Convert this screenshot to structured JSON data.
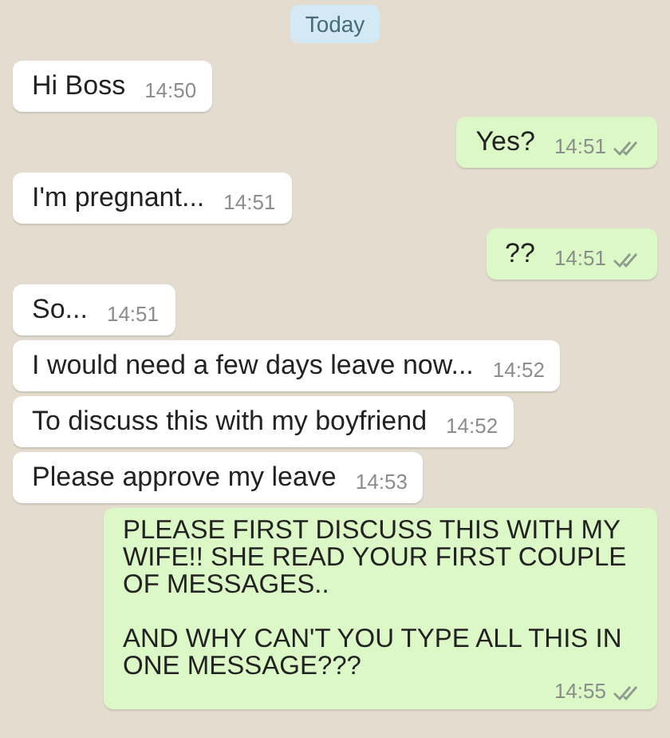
{
  "date_badge": "Today",
  "messages": [
    {
      "text": "Hi Boss",
      "time": "14:50",
      "outgoing": false
    },
    {
      "text": "Yes?",
      "time": "14:51",
      "outgoing": true
    },
    {
      "text": "I'm pregnant...",
      "time": "14:51",
      "outgoing": false
    },
    {
      "text": "??",
      "time": "14:51",
      "outgoing": true
    },
    {
      "text": "So...",
      "time": "14:51",
      "outgoing": false
    },
    {
      "text": "I would need a few days leave now...",
      "time": "14:52",
      "outgoing": false
    },
    {
      "text": "To discuss this with my boyfriend",
      "time": "14:52",
      "outgoing": false
    },
    {
      "text": "Please approve my leave",
      "time": "14:53",
      "outgoing": false
    },
    {
      "text": "PLEASE FIRST DISCUSS THIS WITH MY WIFE!! SHE READ YOUR FIRST COUPLE OF MESSAGES..\n\nAND WHY CAN'T YOU TYPE ALL THIS IN ONE MESSAGE???",
      "time": "14:55",
      "outgoing": true
    }
  ]
}
